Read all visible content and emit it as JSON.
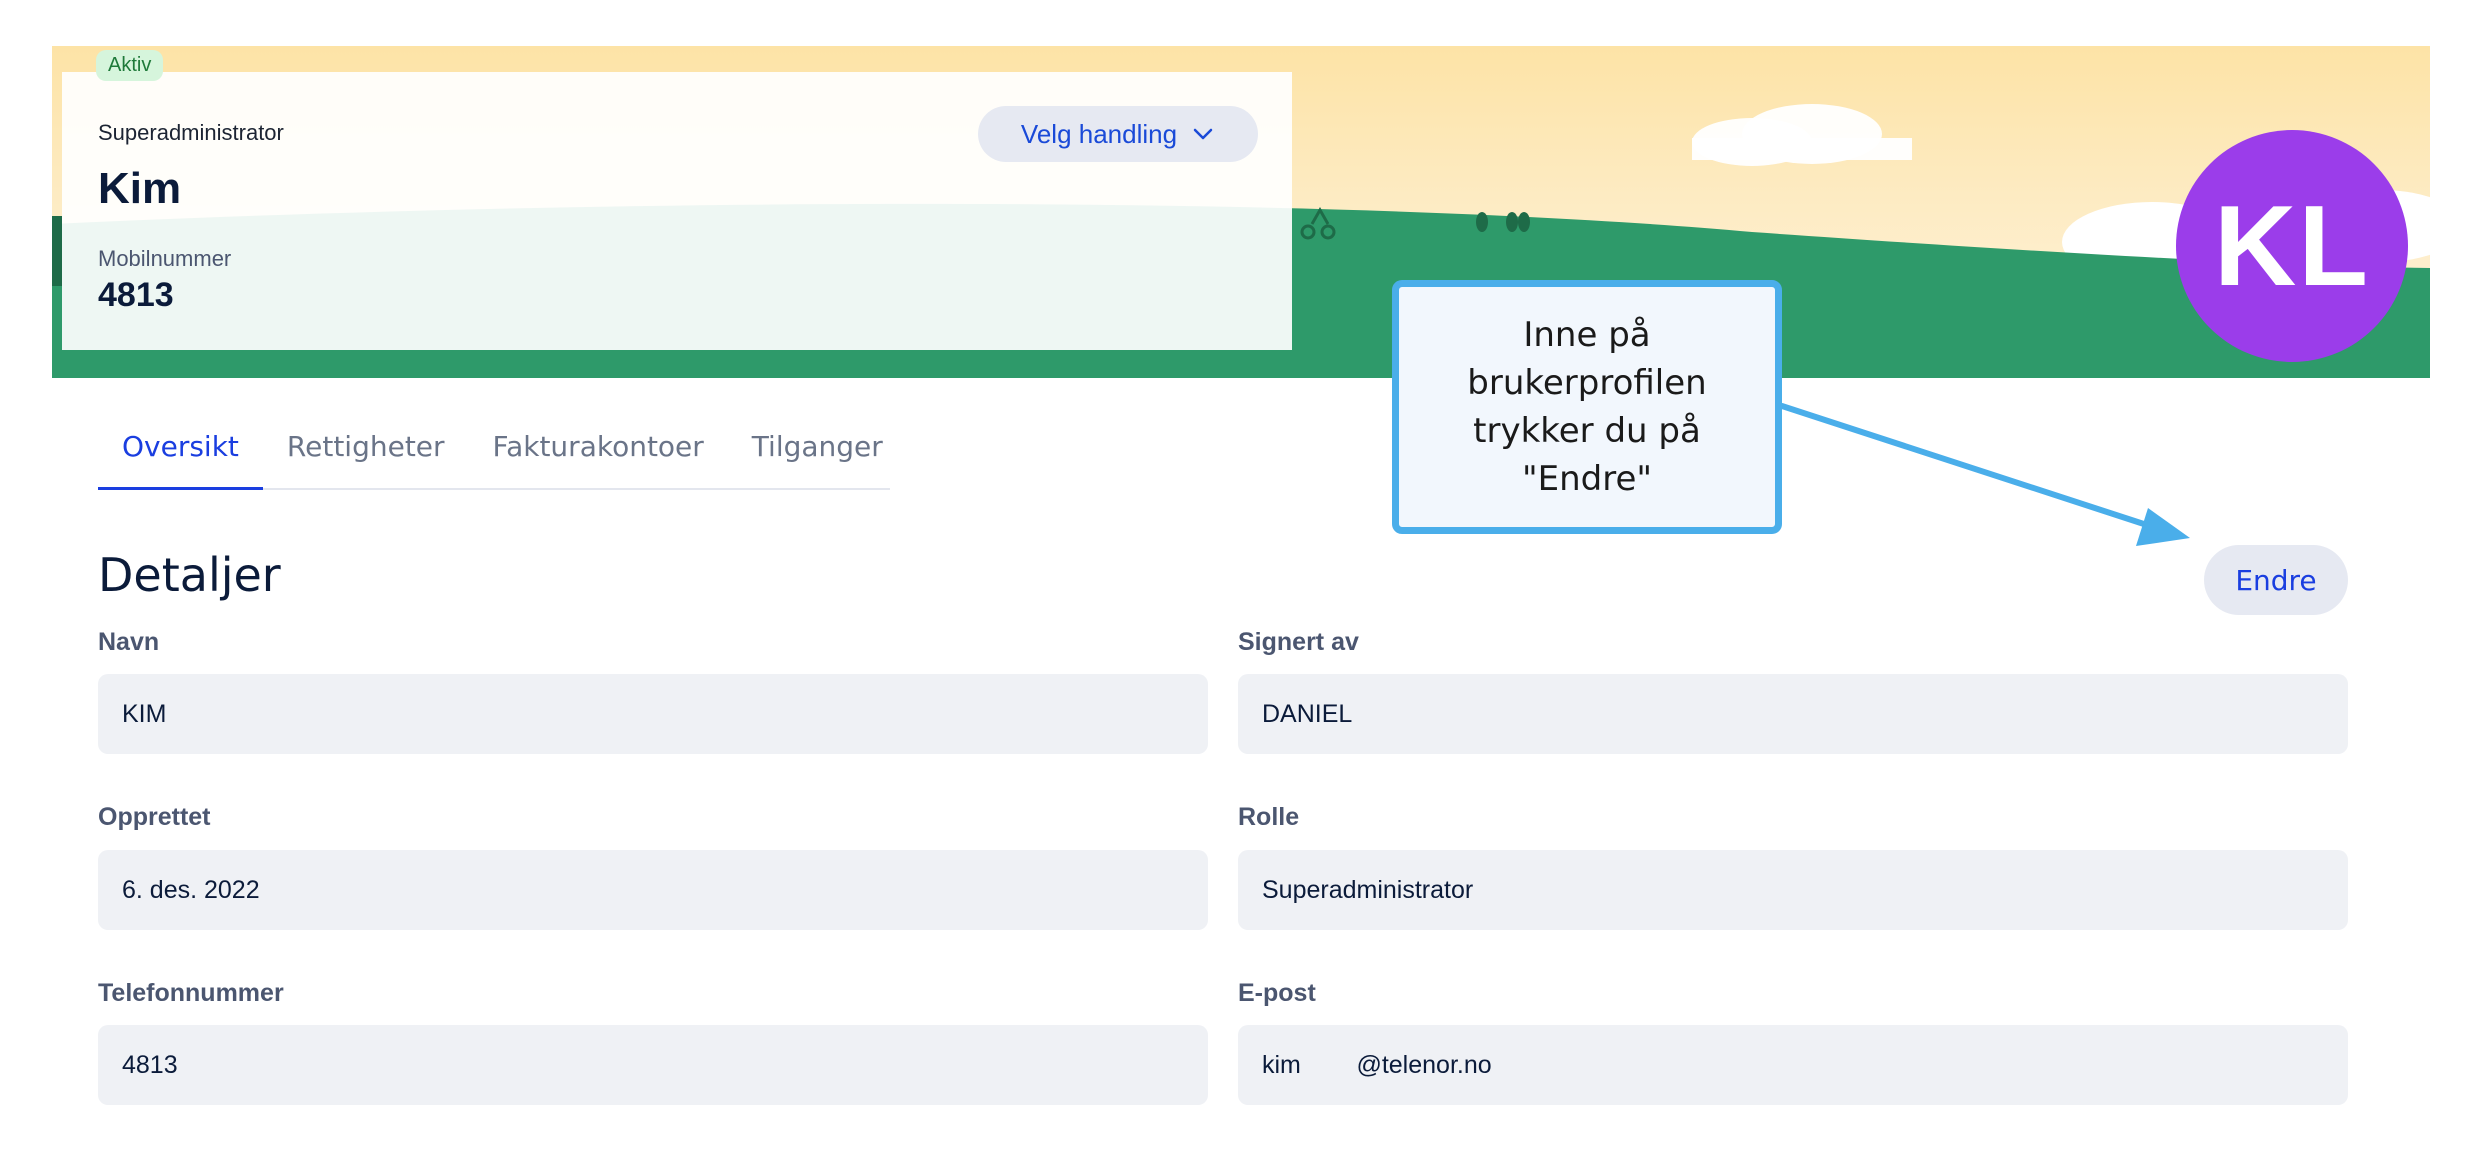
{
  "profile": {
    "status": "Aktiv",
    "role": "Superadministrator",
    "name": "Kim",
    "mobile_label": "Mobilnummer",
    "mobile_value": "4813",
    "avatar_initials": "KL",
    "action_label": "Velg handling"
  },
  "tabs": [
    {
      "label": "Oversikt",
      "active": true
    },
    {
      "label": "Rettigheter",
      "active": false
    },
    {
      "label": "Fakturakontoer",
      "active": false
    },
    {
      "label": "Tilganger",
      "active": false
    }
  ],
  "details": {
    "title": "Detaljer",
    "edit_label": "Endre",
    "fields": [
      {
        "label": "Navn",
        "value": "KIM"
      },
      {
        "label": "Signert av",
        "value": "DANIEL"
      },
      {
        "label": "Opprettet",
        "value": "6. des. 2022"
      },
      {
        "label": "Rolle",
        "value": "Superadministrator"
      },
      {
        "label": "Telefonnummer",
        "value": "4813"
      },
      {
        "label": "E-post",
        "value": "kim        @telenor.no"
      }
    ]
  },
  "callout": {
    "text": "Inne på brukerprofilen trykker du på \"Endre\""
  },
  "colors": {
    "accent": "#1a3ee0",
    "avatar": "#9b3dea",
    "hill": "#2e9a6a",
    "callout_border": "#4aaeea"
  },
  "icons": {
    "action_chevron": "chevron-down-icon"
  }
}
